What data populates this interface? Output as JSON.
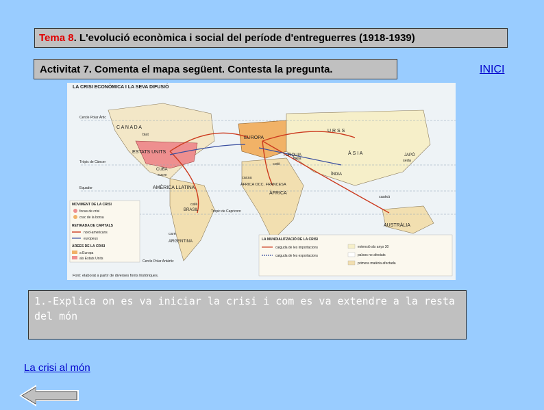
{
  "header": {
    "tema_label": "Tema 8",
    "title_rest": ". L'evolució econòmica i social del període d'entreguerres (1918-1939)"
  },
  "activity": {
    "label": "Activitat 7.  Comenta el mapa següent. Contesta la pregunta."
  },
  "nav": {
    "inici_label": "INICI",
    "link_label": "La crisi al món",
    "back_icon": "left-arrow-icon"
  },
  "question": {
    "text": "1.-Explica on es va iniciar la crisi i com es va extendre a la resta del món"
  },
  "map": {
    "title": "LA CRISI ECONÒMICA I LA SEVA DIFUSIÓ",
    "regions": {
      "canada": "C A N A D A",
      "usa": "ESTATS UNITS",
      "europa": "EUROPA",
      "urss": "U R S S",
      "asia": "Á S I A",
      "america_llatina": "AMÈRICA LLATINA",
      "africa": "ÀFRICA",
      "australia": "AUSTRÀLIA",
      "india": "ÍNDIA",
      "japo": "JAPÓ",
      "brasil": "BRASIL",
      "argentina": "ARGENTINA",
      "cuba": "CUBA",
      "turquia": "TURQUIA",
      "africa_occ": "ÀFRICA OCC. FRANCESA"
    },
    "products": {
      "blat": "blat",
      "sucre": "sucre",
      "cafe": "cafè",
      "cotó": "cotó",
      "llana": "llana",
      "seda": "seda",
      "carn": "carn",
      "cautxu": "cautxú",
      "cacau": "cacau"
    },
    "geo": {
      "cercle_polar_artic": "Cercle Polar Àrtic",
      "tropic_cancer": "Tròpic de Càncer",
      "equador": "Equador",
      "tropic_capricorn": "Tròpic de Capricorn",
      "cercle_polar_antartic": "Cercle Polar Antàrtic"
    },
    "legend_left": {
      "title1": "MOVIMENT DE LA CRISI",
      "item1": "focus de crisi",
      "item2": "crac de la borsa",
      "title2": "RETIRADA DE CAPITALS",
      "item3": "nord-americans",
      "item4": "europeus",
      "title3": "ÀREES DE LA CRISI",
      "item5": "a Europa",
      "item6": "als Estats Units"
    },
    "legend_right": {
      "title": "LA MUNDIALITZACIÓ DE LA CRISI",
      "item1": "caiguda de les importacions",
      "item2": "caiguda de les exportacions",
      "item3": "extensió als anys 30",
      "item4": "països no afectats",
      "item5": "primera matèria afectada"
    },
    "source": "Font: elaborat a partir de diverses fonts històriques."
  },
  "colors": {
    "background": "#99ccff",
    "box_gray": "#c0c0c0",
    "tema_red": "#e00000",
    "link_blue": "#0000cc",
    "crisis_red": "#cc3b1f",
    "capital_blue": "#3a4fa0"
  }
}
